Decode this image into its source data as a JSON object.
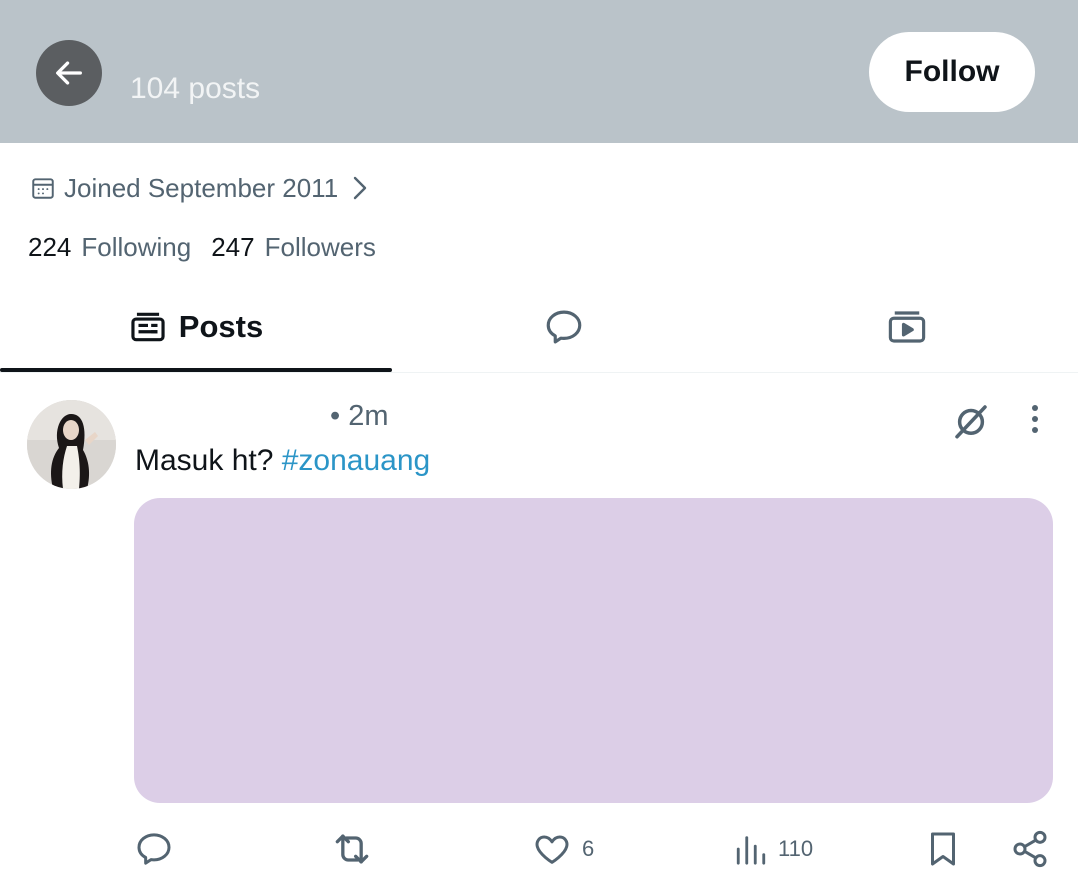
{
  "header": {
    "post_count": "104 posts",
    "follow_label": "Follow",
    "bg_color": "#bac3c9"
  },
  "profile": {
    "joined": "Joined September 2011",
    "following_count": "224",
    "following_label": "Following",
    "followers_count": "247",
    "followers_label": "Followers"
  },
  "tabs": [
    {
      "label": "Posts",
      "icon": "posts-icon",
      "active": true
    },
    {
      "label": "",
      "icon": "replies-icon",
      "active": false
    },
    {
      "label": "",
      "icon": "media-icon",
      "active": false
    }
  ],
  "post": {
    "time": "• 2m",
    "text": "Masuk ht?",
    "hashtag": "#zonauang",
    "media_color": "#dccee7",
    "actions": {
      "reply": "",
      "repost": "",
      "likes": "6",
      "views": "110"
    }
  }
}
